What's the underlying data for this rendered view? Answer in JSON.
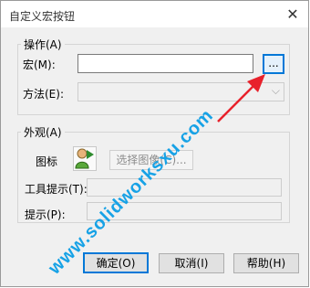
{
  "window": {
    "title": "自定义宏按钮",
    "close_glyph": "✕"
  },
  "operation_group": {
    "legend": "操作(A)",
    "macro_label": "宏(M):",
    "macro_value": "",
    "browse_label": "...",
    "method_label": "方法(E):",
    "method_value": "",
    "method_arrow": "⌵"
  },
  "appearance_group": {
    "legend": "外观(A)",
    "icon_label": "图标",
    "select_image_label": "选择图像(C)...",
    "tooltip_label": "工具提示(T):",
    "tooltip_value": "",
    "prompt_label": "提示(P):",
    "prompt_value": ""
  },
  "buttons": {
    "ok": "确定(O)",
    "cancel": "取消(I)",
    "help": "帮助(H)"
  },
  "watermark": {
    "text": "www.solidworksxu.com",
    "color": "#17a2e6"
  },
  "annotation": {
    "arrow_color": "#e8212b"
  }
}
